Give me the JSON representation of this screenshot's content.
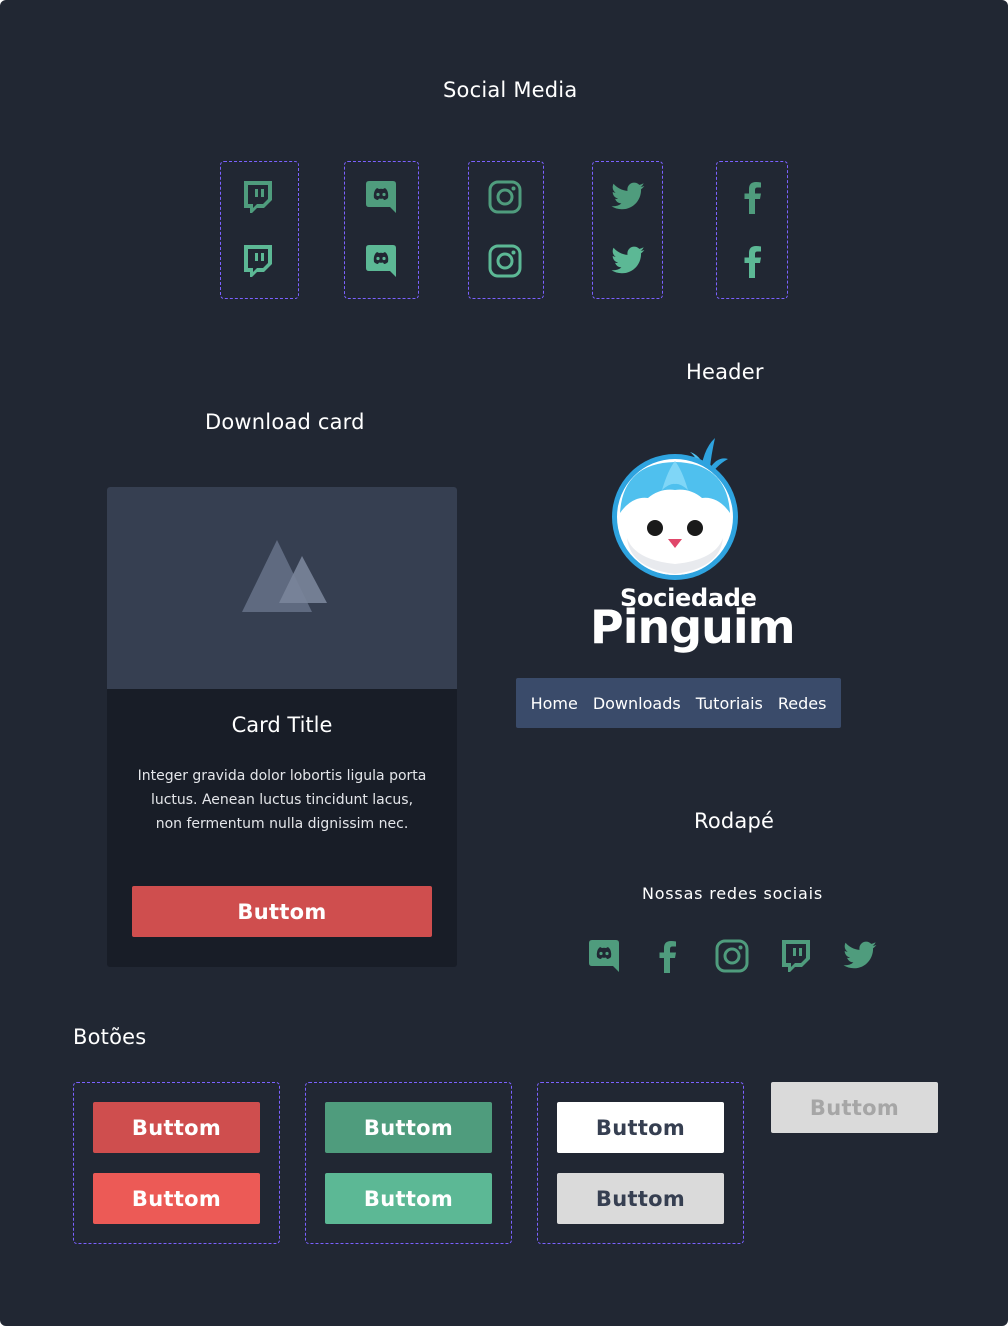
{
  "colors": {
    "background": "#212733",
    "accent_green": "#5cb895",
    "accent_green_dark": "#4f9c7d",
    "accent_red": "#cf4e4e",
    "accent_red_light": "#ec5a56",
    "dashed_border": "#7b61ff",
    "nav_bg": "#3a4b6a"
  },
  "social_media": {
    "title": "Social Media",
    "icons": [
      "twitch-icon",
      "discord-icon",
      "instagram-icon",
      "twitter-icon",
      "facebook-icon"
    ]
  },
  "download_card": {
    "section_title": "Download card",
    "image_icon": "image-placeholder-icon",
    "title": "Card Title",
    "text": "Integer gravida dolor lobortis ligula porta luctus. Aenean luctus tincidunt lacus, non fermentum nulla dignissim nec.",
    "button_label": "Buttom"
  },
  "header": {
    "section_title": "Header",
    "logo_line1": "Sociedade",
    "logo_line2": "Pinguim",
    "nav": [
      "Home",
      "Downloads",
      "Tutoriais",
      "Redes"
    ]
  },
  "footer": {
    "section_title": "Rodapé",
    "subtitle": "Nossas redes sociais",
    "icons": [
      "discord-icon",
      "facebook-icon",
      "instagram-icon",
      "twitch-icon",
      "twitter-icon"
    ]
  },
  "buttons": {
    "section_title": "Botões",
    "label": "Buttom",
    "groups": [
      {
        "variant": "red",
        "normal": "#cf4e4e",
        "hover": "#ec5a56"
      },
      {
        "variant": "green",
        "normal": "#4f9c7d",
        "hover": "#5cb895"
      },
      {
        "variant": "white",
        "normal": "#ffffff",
        "hover": "#dadada"
      },
      {
        "variant": "disabled",
        "normal": "#dadada"
      }
    ]
  }
}
